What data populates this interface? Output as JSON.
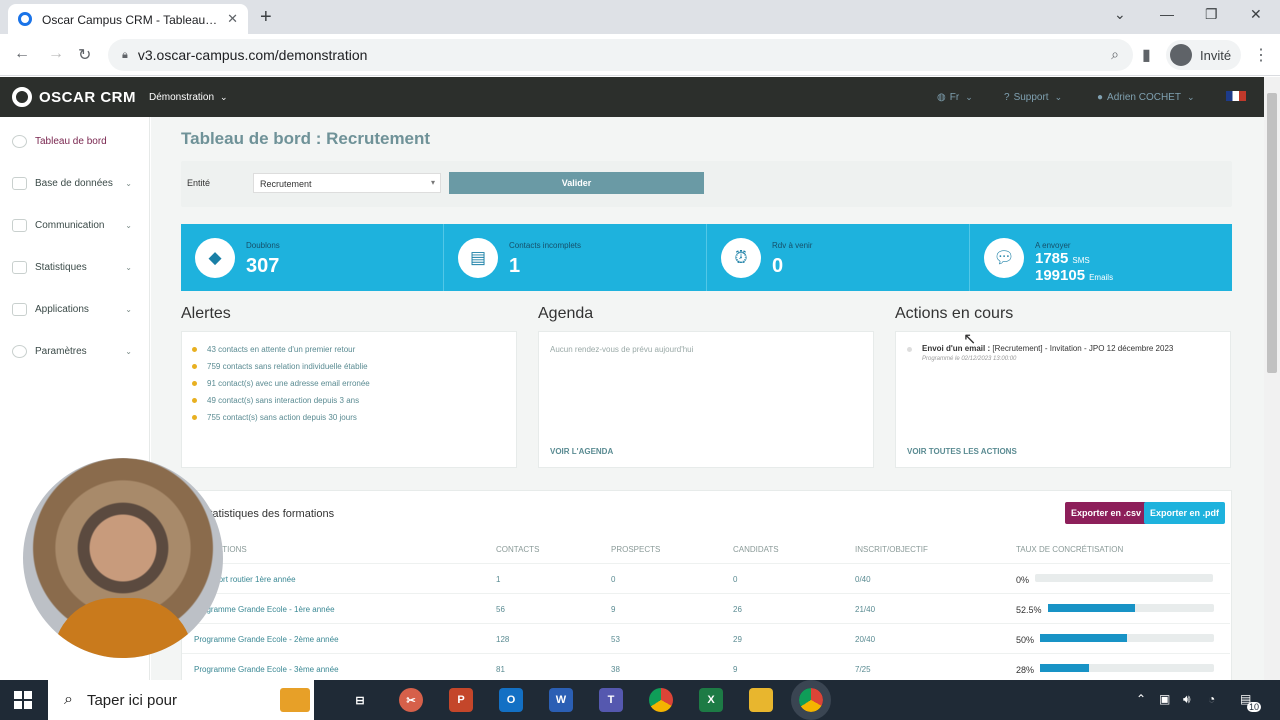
{
  "browser": {
    "tab_title": "Oscar Campus CRM - Tableau de bord",
    "url": "v3.oscar-campus.com/demonstration",
    "profile": "Invité"
  },
  "app": {
    "logo": "OSCAR CRM",
    "workspace": "Démonstration",
    "lang": "Fr",
    "support": "Support",
    "user": "Adrien COCHET"
  },
  "sidebar": {
    "items": [
      {
        "label": "Tableau de bord"
      },
      {
        "label": "Base de données"
      },
      {
        "label": "Communication"
      },
      {
        "label": "Statistiques"
      },
      {
        "label": "Applications"
      },
      {
        "label": "Paramètres"
      }
    ]
  },
  "page": {
    "title": "Tableau de bord : Recrutement",
    "filter_label": "Entité",
    "filter_value": "Recrutement",
    "validate": "Valider"
  },
  "stats": {
    "doublons_label": "Doublons",
    "doublons_value": "307",
    "incomplets_label": "Contacts incomplets",
    "incomplets_value": "1",
    "rdv_label": "Rdv à venir",
    "rdv_value": "0",
    "envoyer_label": "A envoyer",
    "sms_value": "1785",
    "sms_unit": "SMS",
    "emails_value": "199105",
    "emails_unit": "Emails"
  },
  "alertes": {
    "title": "Alertes",
    "items": [
      "43 contacts en attente d'un premier retour",
      "759 contacts sans relation individuelle établie",
      "91 contact(s) avec une adresse email erronée",
      "49 contact(s) sans interaction depuis 3 ans",
      "755 contact(s) sans action depuis 30 jours"
    ]
  },
  "agenda": {
    "title": "Agenda",
    "empty": "Aucun rendez-vous de prévu aujourd'hui",
    "link": "VOIR L'AGENDA"
  },
  "actions": {
    "title": "Actions en cours",
    "item_type": "Envoi d'un email :",
    "item_text": "[Recrutement] - Invitation - JPO 12 décembre 2023",
    "item_sub": "Programmé le 02/12/2023 13:00:00",
    "link": "VOIR TOUTES LES ACTIONS"
  },
  "formations": {
    "title": "Statistiques des formations",
    "export_csv": "Exporter en .csv",
    "export_pdf": "Exporter en .pdf",
    "headers": [
      "FORMATIONS",
      "CONTACTS",
      "PROSPECTS",
      "CANDIDATS",
      "INSCRIT/OBJECTIF",
      "TAUX DE CONCRÉTISATION"
    ],
    "rows": [
      {
        "name": "Transport routier 1ère année",
        "contacts": "1",
        "prospects": "0",
        "candidats": "0",
        "inscrits": "0/40",
        "taux": "0%",
        "fill": 0
      },
      {
        "name": "Programme Grande Ecole - 1ère année",
        "contacts": "56",
        "prospects": "9",
        "candidats": "26",
        "inscrits": "21/40",
        "taux": "52.5%",
        "fill": 52.5
      },
      {
        "name": "Programme Grande Ecole - 2ème année",
        "contacts": "128",
        "prospects": "53",
        "candidats": "29",
        "inscrits": "20/40",
        "taux": "50%",
        "fill": 50
      },
      {
        "name": "Programme Grande Ecole - 3ème année",
        "contacts": "81",
        "prospects": "38",
        "candidats": "9",
        "inscrits": "7/25",
        "taux": "28%",
        "fill": 28
      }
    ]
  },
  "taskbar": {
    "search_placeholder": "Taper ici pour",
    "notif_count": "10"
  },
  "colors": {
    "stat_band": "#1eb2dd",
    "export_csv": "#8d1f5a",
    "export_pdf": "#1eb2dd",
    "progress": "#1893c6"
  }
}
